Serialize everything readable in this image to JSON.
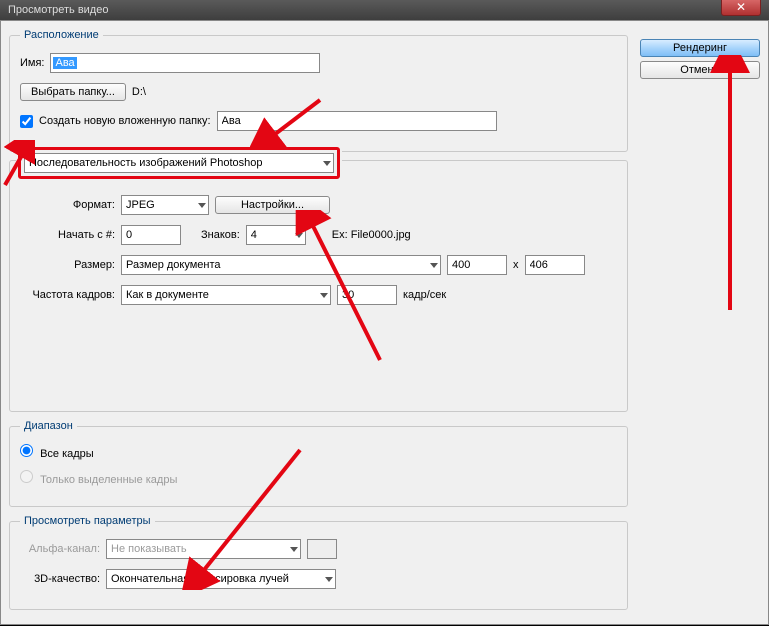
{
  "title": "Просмотреть видео",
  "location": {
    "legend": "Расположение",
    "name_label": "Имя:",
    "name_value": "Ава",
    "choose_folder": "Выбрать папку...",
    "path": "D:\\",
    "create_subfolder_label": "Создать новую вложенную папку:",
    "subfolder_value": "Ава"
  },
  "format": {
    "type": "Последовательность изображений Photoshop",
    "format_label": "Формат:",
    "format_value": "JPEG",
    "settings": "Настройки...",
    "start_label": "Начать с #:",
    "start_value": "0",
    "digits_label": "Знаков:",
    "digits_value": "4",
    "example_label": "Ex: File0000.jpg",
    "size_label": "Размер:",
    "size_value": "Размер документа",
    "width": "400",
    "x": "x",
    "height": "406",
    "fps_label": "Частота кадров:",
    "fps_value": "Как в документе",
    "fps_num": "30",
    "fps_unit": "кадр/сек"
  },
  "range": {
    "legend": "Диапазон",
    "all_frames": "Все кадры",
    "selected_frames": "Только выделенные кадры"
  },
  "preview": {
    "legend": "Просмотреть параметры",
    "alpha_label": "Альфа-канал:",
    "alpha_value": "Не показывать",
    "quality_label": "3D-качество:",
    "quality_value": "Окончательная трассировка лучей"
  },
  "buttons": {
    "render": "Рендеринг",
    "cancel": "Отмена"
  }
}
